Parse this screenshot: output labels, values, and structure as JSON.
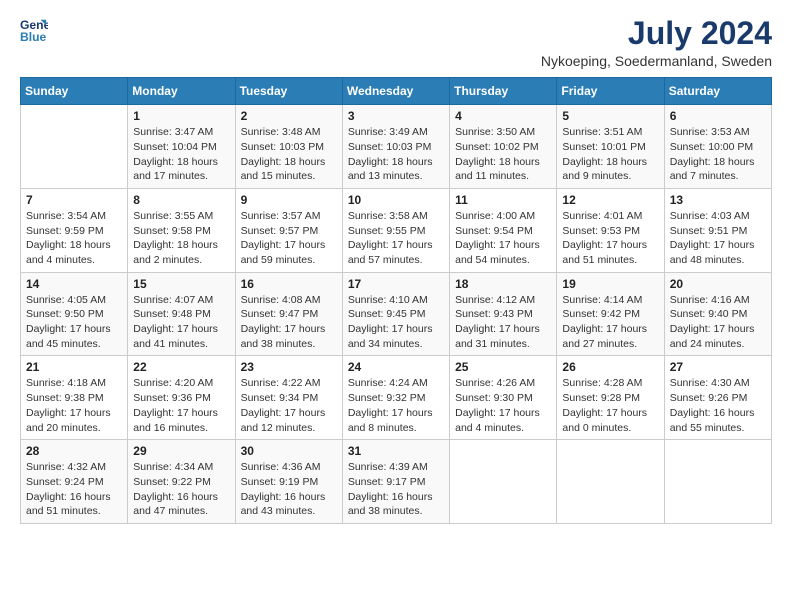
{
  "header": {
    "logo_line1": "General",
    "logo_line2": "Blue",
    "month_year": "July 2024",
    "location": "Nykoeping, Soedermanland, Sweden"
  },
  "days_of_week": [
    "Sunday",
    "Monday",
    "Tuesday",
    "Wednesday",
    "Thursday",
    "Friday",
    "Saturday"
  ],
  "weeks": [
    [
      {
        "day": "",
        "info": ""
      },
      {
        "day": "1",
        "info": "Sunrise: 3:47 AM\nSunset: 10:04 PM\nDaylight: 18 hours\nand 17 minutes."
      },
      {
        "day": "2",
        "info": "Sunrise: 3:48 AM\nSunset: 10:03 PM\nDaylight: 18 hours\nand 15 minutes."
      },
      {
        "day": "3",
        "info": "Sunrise: 3:49 AM\nSunset: 10:03 PM\nDaylight: 18 hours\nand 13 minutes."
      },
      {
        "day": "4",
        "info": "Sunrise: 3:50 AM\nSunset: 10:02 PM\nDaylight: 18 hours\nand 11 minutes."
      },
      {
        "day": "5",
        "info": "Sunrise: 3:51 AM\nSunset: 10:01 PM\nDaylight: 18 hours\nand 9 minutes."
      },
      {
        "day": "6",
        "info": "Sunrise: 3:53 AM\nSunset: 10:00 PM\nDaylight: 18 hours\nand 7 minutes."
      }
    ],
    [
      {
        "day": "7",
        "info": "Sunrise: 3:54 AM\nSunset: 9:59 PM\nDaylight: 18 hours\nand 4 minutes."
      },
      {
        "day": "8",
        "info": "Sunrise: 3:55 AM\nSunset: 9:58 PM\nDaylight: 18 hours\nand 2 minutes."
      },
      {
        "day": "9",
        "info": "Sunrise: 3:57 AM\nSunset: 9:57 PM\nDaylight: 17 hours\nand 59 minutes."
      },
      {
        "day": "10",
        "info": "Sunrise: 3:58 AM\nSunset: 9:55 PM\nDaylight: 17 hours\nand 57 minutes."
      },
      {
        "day": "11",
        "info": "Sunrise: 4:00 AM\nSunset: 9:54 PM\nDaylight: 17 hours\nand 54 minutes."
      },
      {
        "day": "12",
        "info": "Sunrise: 4:01 AM\nSunset: 9:53 PM\nDaylight: 17 hours\nand 51 minutes."
      },
      {
        "day": "13",
        "info": "Sunrise: 4:03 AM\nSunset: 9:51 PM\nDaylight: 17 hours\nand 48 minutes."
      }
    ],
    [
      {
        "day": "14",
        "info": "Sunrise: 4:05 AM\nSunset: 9:50 PM\nDaylight: 17 hours\nand 45 minutes."
      },
      {
        "day": "15",
        "info": "Sunrise: 4:07 AM\nSunset: 9:48 PM\nDaylight: 17 hours\nand 41 minutes."
      },
      {
        "day": "16",
        "info": "Sunrise: 4:08 AM\nSunset: 9:47 PM\nDaylight: 17 hours\nand 38 minutes."
      },
      {
        "day": "17",
        "info": "Sunrise: 4:10 AM\nSunset: 9:45 PM\nDaylight: 17 hours\nand 34 minutes."
      },
      {
        "day": "18",
        "info": "Sunrise: 4:12 AM\nSunset: 9:43 PM\nDaylight: 17 hours\nand 31 minutes."
      },
      {
        "day": "19",
        "info": "Sunrise: 4:14 AM\nSunset: 9:42 PM\nDaylight: 17 hours\nand 27 minutes."
      },
      {
        "day": "20",
        "info": "Sunrise: 4:16 AM\nSunset: 9:40 PM\nDaylight: 17 hours\nand 24 minutes."
      }
    ],
    [
      {
        "day": "21",
        "info": "Sunrise: 4:18 AM\nSunset: 9:38 PM\nDaylight: 17 hours\nand 20 minutes."
      },
      {
        "day": "22",
        "info": "Sunrise: 4:20 AM\nSunset: 9:36 PM\nDaylight: 17 hours\nand 16 minutes."
      },
      {
        "day": "23",
        "info": "Sunrise: 4:22 AM\nSunset: 9:34 PM\nDaylight: 17 hours\nand 12 minutes."
      },
      {
        "day": "24",
        "info": "Sunrise: 4:24 AM\nSunset: 9:32 PM\nDaylight: 17 hours\nand 8 minutes."
      },
      {
        "day": "25",
        "info": "Sunrise: 4:26 AM\nSunset: 9:30 PM\nDaylight: 17 hours\nand 4 minutes."
      },
      {
        "day": "26",
        "info": "Sunrise: 4:28 AM\nSunset: 9:28 PM\nDaylight: 17 hours\nand 0 minutes."
      },
      {
        "day": "27",
        "info": "Sunrise: 4:30 AM\nSunset: 9:26 PM\nDaylight: 16 hours\nand 55 minutes."
      }
    ],
    [
      {
        "day": "28",
        "info": "Sunrise: 4:32 AM\nSunset: 9:24 PM\nDaylight: 16 hours\nand 51 minutes."
      },
      {
        "day": "29",
        "info": "Sunrise: 4:34 AM\nSunset: 9:22 PM\nDaylight: 16 hours\nand 47 minutes."
      },
      {
        "day": "30",
        "info": "Sunrise: 4:36 AM\nSunset: 9:19 PM\nDaylight: 16 hours\nand 43 minutes."
      },
      {
        "day": "31",
        "info": "Sunrise: 4:39 AM\nSunset: 9:17 PM\nDaylight: 16 hours\nand 38 minutes."
      },
      {
        "day": "",
        "info": ""
      },
      {
        "day": "",
        "info": ""
      },
      {
        "day": "",
        "info": ""
      }
    ]
  ]
}
